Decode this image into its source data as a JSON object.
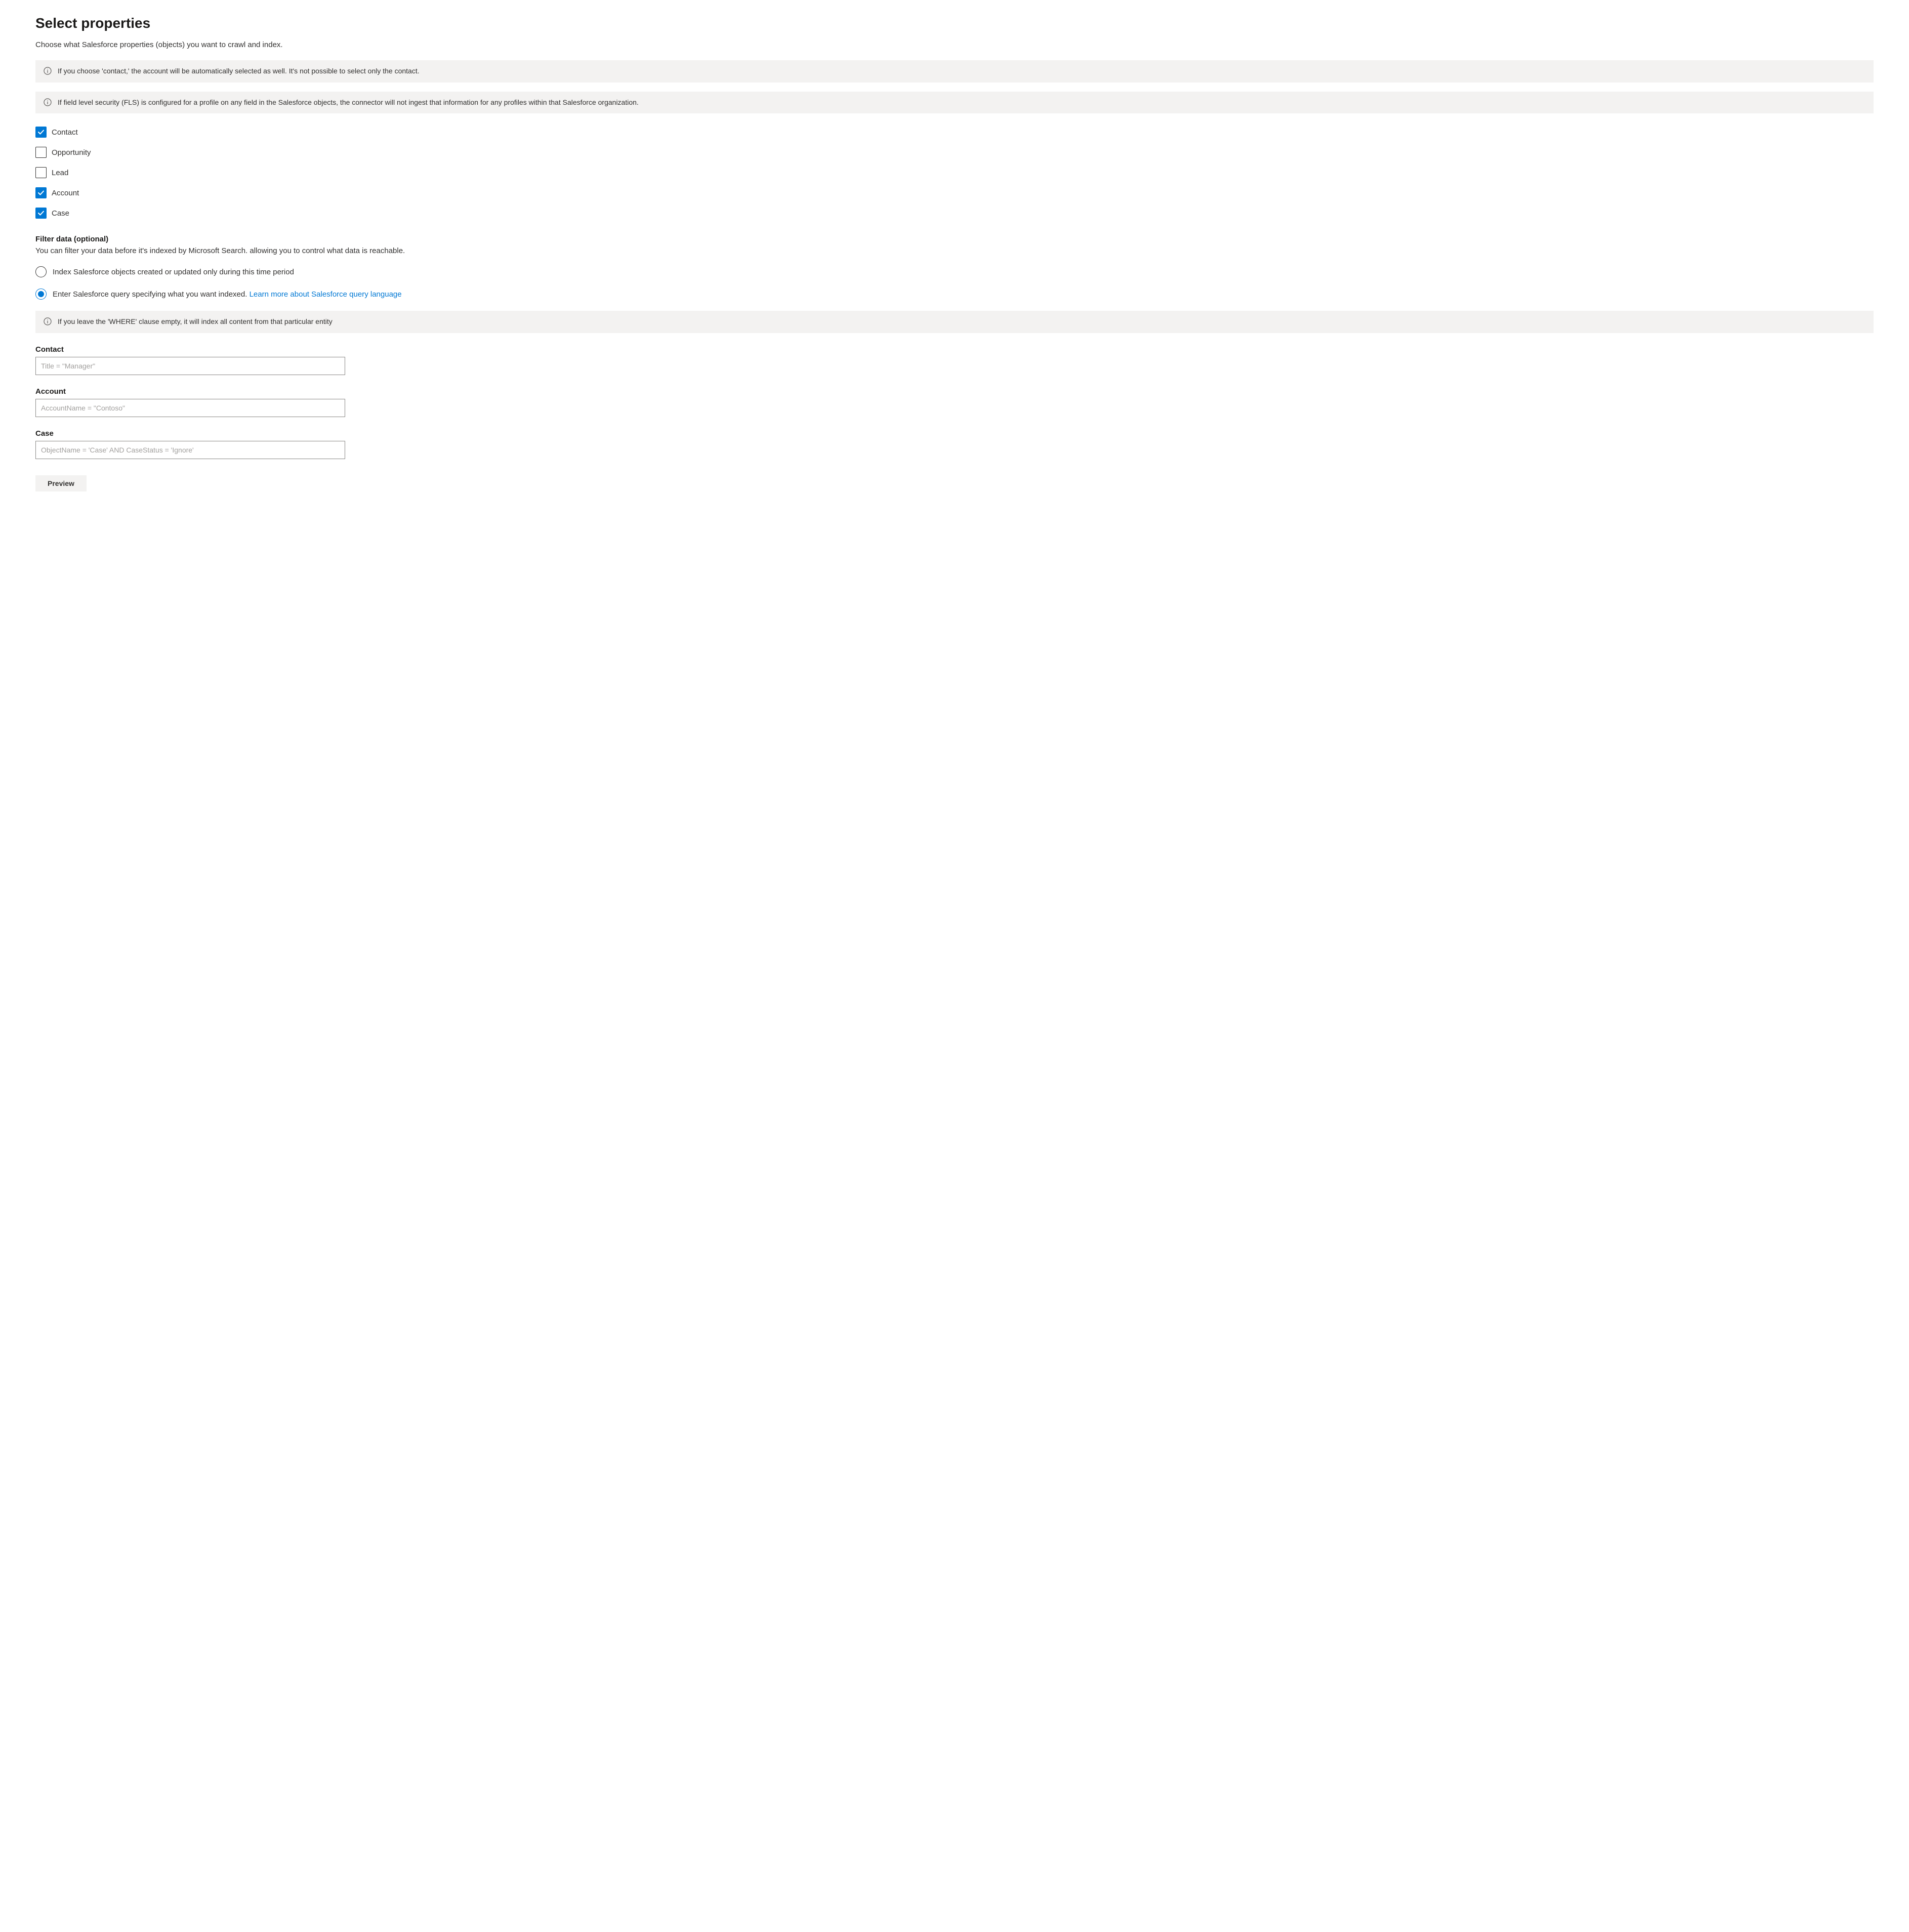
{
  "page": {
    "title": "Select properties",
    "subtitle": "Choose what Salesforce properties (objects) you want to crawl and index."
  },
  "banners": {
    "contact_auto": "If you choose 'contact,' the account will be automatically selected as well. It's not possible to select only the contact.",
    "fls": "If field level security (FLS) is configured for a profile on any field in the Salesforce objects, the connector will not ingest that information for any profiles within that Salesforce organization.",
    "where_empty": "If you leave the 'WHERE' clause empty, it will index all content from that particular entity"
  },
  "checkboxes": [
    {
      "label": "Contact",
      "checked": true
    },
    {
      "label": "Opportunity",
      "checked": false
    },
    {
      "label": "Lead",
      "checked": false
    },
    {
      "label": "Account",
      "checked": true
    },
    {
      "label": "Case",
      "checked": true
    }
  ],
  "filter": {
    "heading": "Filter data (optional)",
    "description": "You can filter your data before it's indexed by Microsoft Search. allowing you to control what data is reachable."
  },
  "radios": {
    "time_period": "Index Salesforce objects created or updated only during this time period",
    "query": "Enter Salesforce query specifying what you want indexed.",
    "learn_link": "Learn more about Salesforce query language"
  },
  "queries": {
    "contact": {
      "label": "Contact",
      "placeholder": "Title = \"Manager\""
    },
    "account": {
      "label": "Account",
      "placeholder": "AccountName = \"Contoso\""
    },
    "case": {
      "label": "Case",
      "placeholder": "ObjectName = 'Case' AND CaseStatus = 'Ignore'"
    }
  },
  "buttons": {
    "preview": "Preview"
  }
}
